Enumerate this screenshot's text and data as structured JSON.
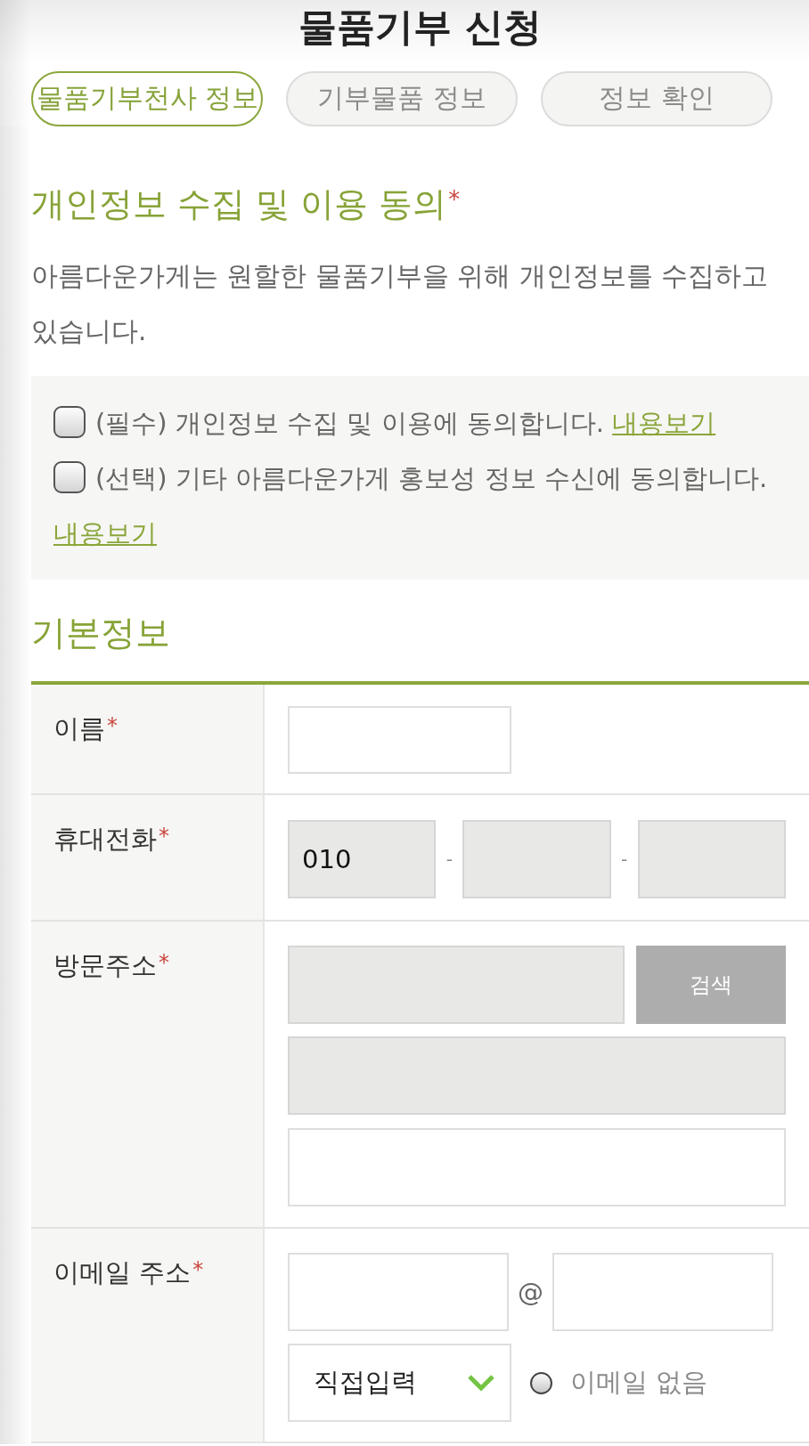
{
  "title": "물품기부 신청",
  "steps": [
    {
      "label": "물품기부천사 정보",
      "selected": true
    },
    {
      "label": "기부물품 정보",
      "selected": false
    },
    {
      "label": "정보 확인",
      "selected": false
    }
  ],
  "consent": {
    "heading": "개인정보 수집 및 이용 동의",
    "required_mark": "*",
    "description": "아름다운가게는 원할한 물품기부을 위해 개인정보를 수집하고 있습니다.",
    "items": [
      {
        "text": "(필수) 개인정보 수집 및 이용에 동의합니다.",
        "link": "내용보기",
        "checked": false
      },
      {
        "text": "(선택) 기타 아름다운가게 홍보성 정보 수신에 동의합니다.",
        "link": "내용보기",
        "checked": false
      }
    ]
  },
  "basic_info": {
    "heading": "기본정보",
    "rows": [
      {
        "kind": "name",
        "label": "이름",
        "required_mark": "*",
        "fields": [
          {
            "readonly": false
          }
        ]
      },
      {
        "kind": "phone",
        "label": "휴대전화",
        "required_mark": "*",
        "fields": [
          {
            "value": "010",
            "readonly": true
          },
          {
            "readonly": true
          },
          {
            "readonly": true
          }
        ],
        "separators": [
          "-",
          "-"
        ]
      },
      {
        "kind": "address",
        "label": "방문주소",
        "required_mark": "*",
        "fields": [
          {
            "readonly": true
          },
          {
            "readonly": true
          },
          {
            "readonly": false
          }
        ],
        "button": "검색"
      },
      {
        "kind": "email",
        "label": "이메일 주소",
        "required_mark": "*",
        "fields": [
          {
            "readonly": false
          },
          {
            "readonly": false
          }
        ],
        "separator": "@",
        "select": {
          "value": "직접입력"
        },
        "option": {
          "label": "이메일 없음",
          "checked": false
        }
      }
    ]
  }
}
